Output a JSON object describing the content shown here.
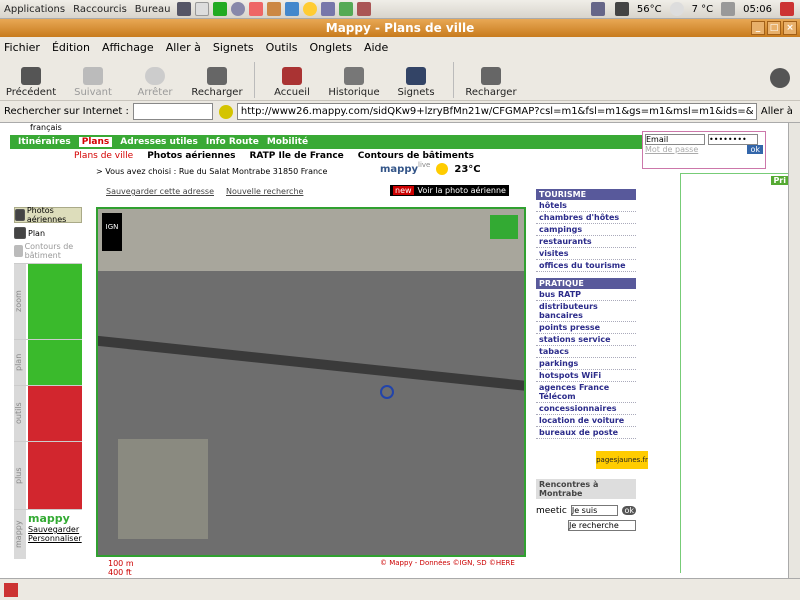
{
  "panel": {
    "menus": [
      "Applications",
      "Raccourcis",
      "Bureau"
    ],
    "cpu_temp": "56°C",
    "weather": "7 °C",
    "clock": "05:06"
  },
  "window": {
    "title": "Mappy - Plans de ville"
  },
  "menubar": [
    "Fichier",
    "Édition",
    "Affichage",
    "Aller à",
    "Signets",
    "Outils",
    "Onglets",
    "Aide"
  ],
  "toolbar": {
    "back": "Précédent",
    "forward": "Suivant",
    "stop": "Arrêter",
    "reload": "Recharger",
    "home": "Accueil",
    "history": "Historique",
    "bookmarks": "Signets",
    "reload2": "Recharger"
  },
  "addr": {
    "search_label": "Rechercher sur Internet :",
    "url": "http://www26.mappy.com/sidQKw9+lzryBfMn21w/CFGMAP?csl=m1&fsl=m1&gs=m1&msl=m1&ids=&xs",
    "go": "Aller à"
  },
  "site": {
    "langue": "français",
    "nav": [
      "Itinéraires",
      "Plans",
      "Adresses utiles",
      "Info Route",
      "Mobilité"
    ],
    "subnav": [
      "Plans de ville",
      "Photos aériennes",
      "RATP Ile de France",
      "Contours de bâtiments"
    ],
    "chosen": "> Vous avez choisi : Rue du Salat Montrabe 31850 France",
    "save_addr": "Sauvegarder cette adresse",
    "new_search": "Nouvelle recherche",
    "mappy_live": "mappy",
    "live": "live",
    "temp": "23°C",
    "new_badge": "new",
    "aerial_link": "Voir la photo aérienne",
    "email_label": "Email",
    "password_mask": "••••••••",
    "forgot": "Mot de passe",
    "ok": "ok",
    "right_ad": "Pri",
    "left_opts": [
      "Photos aériennes",
      "Plan",
      "Contours de bâtiment"
    ],
    "sections": [
      "zoom",
      "plan",
      "outils",
      "plus",
      "mappy"
    ],
    "mappy_bottom": [
      "Sauvegarder",
      "Personnaliser"
    ],
    "ign": "IGN",
    "scale": [
      "100 m",
      "400 ft"
    ],
    "copyright": "© Mappy - Données ©IGN, SD ©HERE",
    "tourisme": {
      "title": "TOURISME",
      "items": [
        "hôtels",
        "chambres d'hôtes",
        "campings",
        "restaurants",
        "visites",
        "offices du tourisme"
      ]
    },
    "pratique": {
      "title": "PRATIQUE",
      "items": [
        "bus RATP",
        "distributeurs bancaires",
        "points presse",
        "stations service",
        "tabacs",
        "parkings",
        "hotspots WiFi",
        "agences France Télécom",
        "concessionnaires",
        "location de voiture",
        "bureaux de poste"
      ]
    },
    "pages_jaunes": "pagesjaunes.fr",
    "rencontres": "Rencontres à Montrabe",
    "meetic": "meetic",
    "je_suis": "Je suis",
    "je_recherche": "Je recherche",
    "go": "ok"
  }
}
